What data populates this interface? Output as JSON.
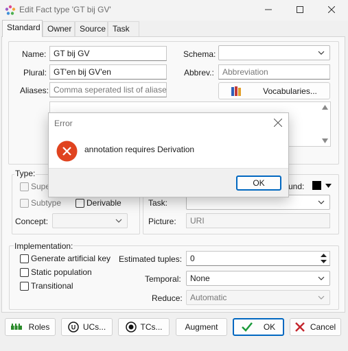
{
  "window": {
    "title": "Edit Fact type 'GT bij GV'"
  },
  "tabs": [
    "Standard",
    "Owner",
    "Source",
    "Task"
  ],
  "form": {
    "name_label": "Name:",
    "name_value": "GT bij GV",
    "plural_label": "Plural:",
    "plural_value": "GT'en bij GV'en",
    "aliases_label": "Aliases:",
    "aliases_placeholder": "Comma seperated list of aliases",
    "schema_label": "Schema:",
    "schema_value": "",
    "abbrev_label": "Abbrev.:",
    "abbrev_placeholder": "Abbreviation",
    "vocabularies_label": "Vocabularies..."
  },
  "type_group": {
    "legend": "Type:",
    "superclass_partial": "Supe",
    "subtype_label": "Subtype",
    "derivable_label": "Derivable",
    "concept_label": "Concept:",
    "background_partial": "und:",
    "task_label": "Task:",
    "picture_label": "Picture:",
    "picture_placeholder": "URI"
  },
  "implementation": {
    "legend": "Implementation:",
    "gen_key_label": "Generate artificial key",
    "static_label": "Static population",
    "transitional_label": "Transitional",
    "est_tuples_label": "Estimated tuples:",
    "est_tuples_value": "0",
    "temporal_label": "Temporal:",
    "temporal_value": "None",
    "reduce_label": "Reduce:",
    "reduce_value": "Automatic"
  },
  "buttons": {
    "roles": "Roles",
    "ucs": "UCs...",
    "tcs": "TCs...",
    "augment": "Augment",
    "ok": "OK",
    "cancel": "Cancel"
  },
  "dialog": {
    "title": "Error",
    "message": "annotation requires Derivation",
    "ok": "OK"
  },
  "colors": {
    "accent": "#0067c0",
    "error": "#e0431f",
    "ok_check": "#1a9a3a",
    "cancel_x": "#c4262e"
  }
}
